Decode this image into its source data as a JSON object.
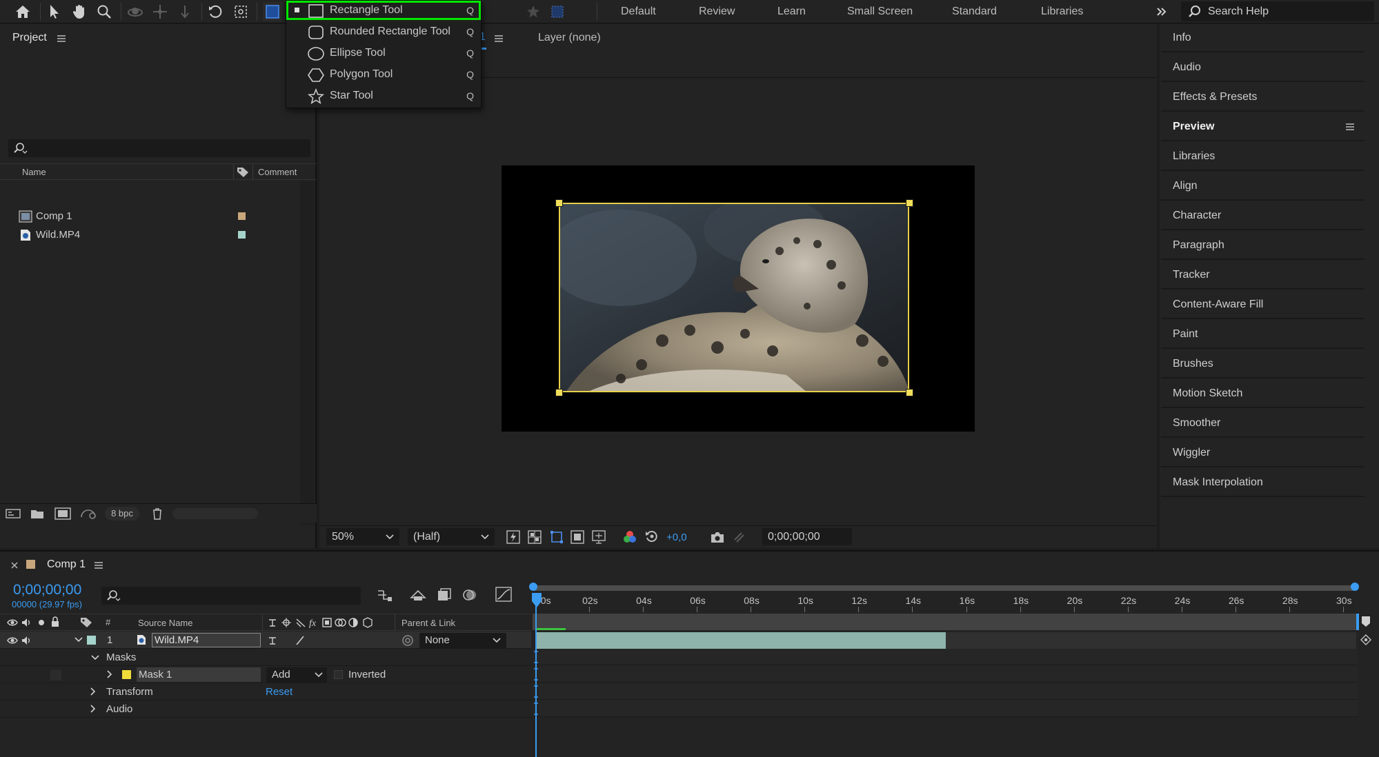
{
  "toolbar": {
    "workspaces": [
      "Default",
      "Review",
      "Learn",
      "Small Screen",
      "Standard",
      "Libraries"
    ],
    "overflow_icon": "double-chevron-right-icon",
    "search_help": "Search Help"
  },
  "shape_menu": {
    "items": [
      {
        "label": "Rectangle Tool",
        "shortcut": "Q",
        "icon": "rectangle-icon",
        "selected": true
      },
      {
        "label": "Rounded Rectangle Tool",
        "shortcut": "Q",
        "icon": "rounded-rectangle-icon",
        "selected": false
      },
      {
        "label": "Ellipse Tool",
        "shortcut": "Q",
        "icon": "ellipse-icon",
        "selected": false
      },
      {
        "label": "Polygon Tool",
        "shortcut": "Q",
        "icon": "polygon-icon",
        "selected": false
      },
      {
        "label": "Star Tool",
        "shortcut": "Q",
        "icon": "star-icon",
        "selected": false
      }
    ],
    "highlight_color": "#00e600"
  },
  "project": {
    "title": "Project",
    "columns": {
      "name": "Name",
      "comment": "Comment"
    },
    "items": [
      {
        "name": "Comp 1",
        "label_color": "#c9a77c",
        "type": "composition"
      },
      {
        "name": "Wild.MP4",
        "label_color": "#a4d4cc",
        "type": "footage"
      }
    ],
    "footer": {
      "bpc": "8 bpc"
    }
  },
  "viewer": {
    "comp_tab_fragment": "1",
    "layer_tab": "Layer (none)",
    "zoom": "50%",
    "resolution": "(Half)",
    "exposure": "+0,0",
    "timecode": "0;00;00;00",
    "mask_color": "#e8d04a"
  },
  "right_panel": {
    "items": [
      "Info",
      "Audio",
      "Effects & Presets",
      "Preview",
      "Libraries",
      "Align",
      "Character",
      "Paragraph",
      "Tracker",
      "Content-Aware Fill",
      "Paint",
      "Brushes",
      "Motion Sketch",
      "Smoother",
      "Wiggler",
      "Mask Interpolation"
    ],
    "active": "Preview"
  },
  "timeline": {
    "comp_name": "Comp 1",
    "timecode": "0;00;00;00",
    "frames_fps": "00000 (29.97 fps)",
    "columns": {
      "number": "#",
      "source_name": "Source Name",
      "parent": "Parent & Link"
    },
    "ruler_labels": [
      "00s",
      "02s",
      "04s",
      "06s",
      "08s",
      "10s",
      "12s",
      "14s",
      "16s",
      "18s",
      "20s",
      "22s",
      "24s",
      "26s",
      "28s",
      "30s"
    ],
    "layer": {
      "number": "1",
      "name": "Wild.MP4",
      "parent": "None",
      "label_color": "#a4d4cc"
    },
    "masks_label": "Masks",
    "mask": {
      "name": "Mask 1",
      "mode": "Add",
      "inverted_label": "Inverted",
      "color": "#f0dd3a"
    },
    "transform_label": "Transform",
    "reset_label": "Reset",
    "audio_label": "Audio",
    "layer_duration_fraction": 0.5
  }
}
